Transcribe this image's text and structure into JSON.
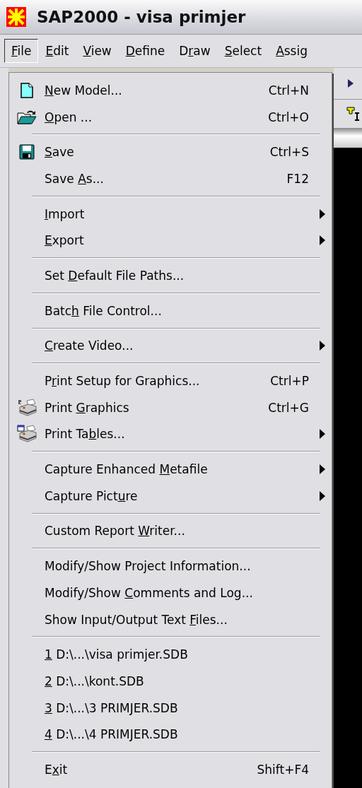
{
  "window": {
    "title": "SAP2000 - visa primjer"
  },
  "menu_bar": [
    {
      "key": "F",
      "after": "ile",
      "selected": true
    },
    {
      "key": "E",
      "after": "dit",
      "selected": false
    },
    {
      "key": "V",
      "after": "iew",
      "selected": false
    },
    {
      "key": "D",
      "after": "efine",
      "selected": false
    },
    {
      "before": "D",
      "key": "r",
      "after": "aw",
      "selected": false
    },
    {
      "key": "S",
      "after": "elect",
      "selected": false
    },
    {
      "key": "A",
      "after": "ssig",
      "selected": false
    }
  ],
  "file_menu": [
    [
      {
        "kind": "new",
        "label": {
          "key": "N",
          "after": "ew Model..."
        },
        "shortcut": "Ctrl+N",
        "submenu": false
      },
      {
        "kind": "open",
        "label": {
          "key": "O",
          "after": "pen ..."
        },
        "shortcut": "Ctrl+O",
        "submenu": false
      }
    ],
    [
      {
        "kind": "save",
        "label": {
          "key": "S",
          "after": "ave"
        },
        "shortcut": "Ctrl+S",
        "submenu": false
      },
      {
        "kind": "plain",
        "label": {
          "before": "Save ",
          "key": "A",
          "after": "s..."
        },
        "shortcut": "F12",
        "submenu": false
      }
    ],
    [
      {
        "kind": "plain",
        "label": {
          "key": "I",
          "after": "mport"
        },
        "submenu": true
      },
      {
        "kind": "plain",
        "label": {
          "key": "E",
          "after": "xport"
        },
        "submenu": true
      }
    ],
    [
      {
        "kind": "plain",
        "label": {
          "before": "Set ",
          "key": "D",
          "after": "efault File Paths..."
        },
        "submenu": false
      }
    ],
    [
      {
        "kind": "plain",
        "label": {
          "before": "Batc",
          "key": "h",
          "after": " File Control..."
        },
        "submenu": false
      }
    ],
    [
      {
        "kind": "plain",
        "label": {
          "key": "C",
          "after": "reate Video..."
        },
        "submenu": true
      }
    ],
    [
      {
        "kind": "plain",
        "label": {
          "before": "P",
          "key": "r",
          "after": "int Setup for Graphics..."
        },
        "shortcut": "Ctrl+P",
        "submenu": false
      },
      {
        "kind": "printer",
        "label": {
          "before": "Print ",
          "key": "G",
          "after": "raphics"
        },
        "shortcut": "Ctrl+G",
        "submenu": false
      },
      {
        "kind": "tableprinter",
        "label": {
          "before": "Print Ta",
          "key": "b",
          "after": "les..."
        },
        "submenu": true
      }
    ],
    [
      {
        "kind": "plain",
        "label": {
          "before": "Capture Enhanced ",
          "key": "M",
          "after": "etafile"
        },
        "submenu": true
      },
      {
        "kind": "plain",
        "label": {
          "before": "Capture Pict",
          "key": "u",
          "after": "re"
        },
        "submenu": true
      }
    ],
    [
      {
        "kind": "plain",
        "label": {
          "before": "Custom Report ",
          "key": "W",
          "after": "riter..."
        },
        "submenu": false
      }
    ],
    [
      {
        "kind": "plain",
        "label": {
          "before": "Modify/Show Pro",
          "key": "j",
          "after": "ect Information..."
        },
        "submenu": false
      },
      {
        "kind": "plain",
        "label": {
          "before": "Modify/Show ",
          "key": "C",
          "after": "omments and Log..."
        },
        "submenu": false
      },
      {
        "kind": "plain",
        "label": {
          "before": "Show Input/Output Text ",
          "key": "F",
          "after": "iles..."
        },
        "submenu": false
      }
    ],
    [
      {
        "kind": "plain",
        "label": {
          "key": "1",
          "after": " D:\\...\\visa primjer.SDB"
        },
        "submenu": false
      },
      {
        "kind": "plain",
        "label": {
          "key": "2",
          "after": " D:\\...\\kont.SDB"
        },
        "submenu": false
      },
      {
        "kind": "plain",
        "label": {
          "key": "3",
          "after": " D:\\...\\3 PRIMJER.SDB"
        },
        "submenu": false
      },
      {
        "kind": "plain",
        "label": {
          "key": "4",
          "after": " D:\\...\\4 PRIMJER.SDB"
        },
        "submenu": false
      }
    ],
    [
      {
        "kind": "plain",
        "label": {
          "before": "E",
          "key": "x",
          "after": "it"
        },
        "shortcut": "Shift+F4",
        "submenu": false
      }
    ]
  ]
}
